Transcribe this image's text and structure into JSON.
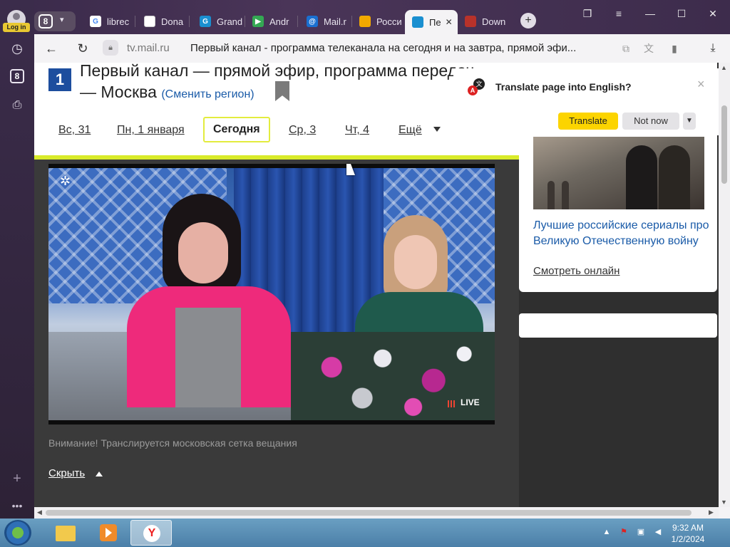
{
  "leftbar": {
    "login_label": "Log in",
    "tab_count": "8"
  },
  "tabs": {
    "count": "8",
    "items": [
      {
        "label": "librec",
        "color": "#4285f4",
        "glyph": "G"
      },
      {
        "label": "Dona",
        "color": "#ffffff",
        "glyph": ""
      },
      {
        "label": "Grand",
        "color": "#1a8fd0",
        "glyph": "G"
      },
      {
        "label": "Andr",
        "color": "#34a853",
        "glyph": "▶"
      },
      {
        "label": "Mail.r",
        "color": "#1a6fd0",
        "glyph": "@"
      },
      {
        "label": "Росси",
        "color": "#f2a900",
        "glyph": ""
      },
      {
        "label": "Пе",
        "color": "#1a8fd0",
        "glyph": ""
      },
      {
        "label": "Down",
        "color": "#b8322a",
        "glyph": ""
      }
    ]
  },
  "toolbar": {
    "url": "tv.mail.ru",
    "page_title": "Первый канал - программа телеканала на сегодня и на завтра, прямой эфи..."
  },
  "page": {
    "title_line1": "Первый канал — прямой эфир, программа передач",
    "title_line2": "— Москва",
    "region_link": "(Сменить регион)",
    "logo_glyph": "1",
    "days": [
      "Вс, 31",
      "Пн, 1 января",
      "Сегодня",
      "Ср, 3",
      "Чт, 4",
      "Ещё"
    ],
    "live_label": "LIVE",
    "notice": "Внимание! Транслируется московская сетка вещания",
    "hide_label": "Скрыть"
  },
  "aside": {
    "card_title": "Лучшие российские сериалы про Великую Отечественную войну",
    "card_link": "Смотреть онлайн"
  },
  "translate": {
    "title": "Translate page into English?",
    "translate_btn": "Translate",
    "not_now_btn": "Not now"
  },
  "taskbar": {
    "time": "9:32 AM",
    "date": "1/2/2024"
  }
}
